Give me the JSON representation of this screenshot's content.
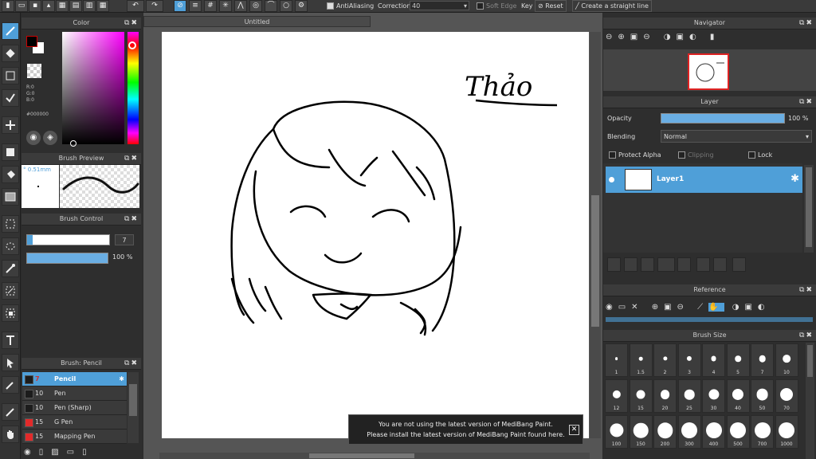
{
  "toolbar": {
    "antialiasing_label": "AntiAliasing",
    "correction_label": "Correction",
    "correction_value": "40",
    "soft_edge_label": "Soft Edge",
    "key_label": "Key",
    "reset_label": "Reset",
    "straight_line_label": "Create a straight line"
  },
  "color_panel": {
    "title": "Color",
    "r": "R:0",
    "g": "G:0",
    "b": "B:0",
    "hex": "#000000",
    "fg_color": "#000000",
    "bg_color": "#ffffff",
    "hue_color": "#ff00ff"
  },
  "brush_preview": {
    "title": "Brush Preview",
    "size": "0.51mm"
  },
  "brush_control": {
    "title": "Brush Control",
    "size_value": "7",
    "size_fraction": 0.07,
    "opacity_value": "100 %",
    "opacity_fraction": 1.0
  },
  "brush_list": {
    "title": "Brush: Pencil",
    "items": [
      {
        "size": "7",
        "name": "Pencil",
        "color": "#1c1c1c",
        "selected": true
      },
      {
        "size": "10",
        "name": "Pen",
        "color": "#1c1c1c"
      },
      {
        "size": "10",
        "name": "Pen (Sharp)",
        "color": "#1c1c1c"
      },
      {
        "size": "15",
        "name": "G Pen",
        "color": "#e22a2a"
      },
      {
        "size": "15",
        "name": "Mapping Pen",
        "color": "#e22a2a"
      }
    ]
  },
  "document": {
    "tab": "Untitled",
    "signature": "Thảo"
  },
  "notice": {
    "line1": "You are not using the latest version of MediBang Paint.",
    "line2": "Please install the latest version of MediBang Paint found here.",
    "close": "✕"
  },
  "navigator": {
    "title": "Navigator"
  },
  "layer_panel": {
    "title": "Layer",
    "opacity_label": "Opacity",
    "opacity_value": "100 %",
    "opacity_fraction": 1.0,
    "blending_label": "Blending",
    "blending_value": "Normal",
    "protect_alpha_label": "Protect Alpha",
    "clipping_label": "Clipping",
    "lock_label": "Lock",
    "layer_name": "Layer1"
  },
  "reference_panel": {
    "title": "Reference"
  },
  "brush_size_panel": {
    "title": "Brush Size",
    "sizes": [
      "1",
      "1.5",
      "2",
      "3",
      "4",
      "5",
      "7",
      "10",
      "12",
      "15",
      "20",
      "25",
      "30",
      "40",
      "50",
      "70",
      "100",
      "150",
      "200",
      "300",
      "400",
      "500",
      "700",
      "1000"
    ]
  }
}
